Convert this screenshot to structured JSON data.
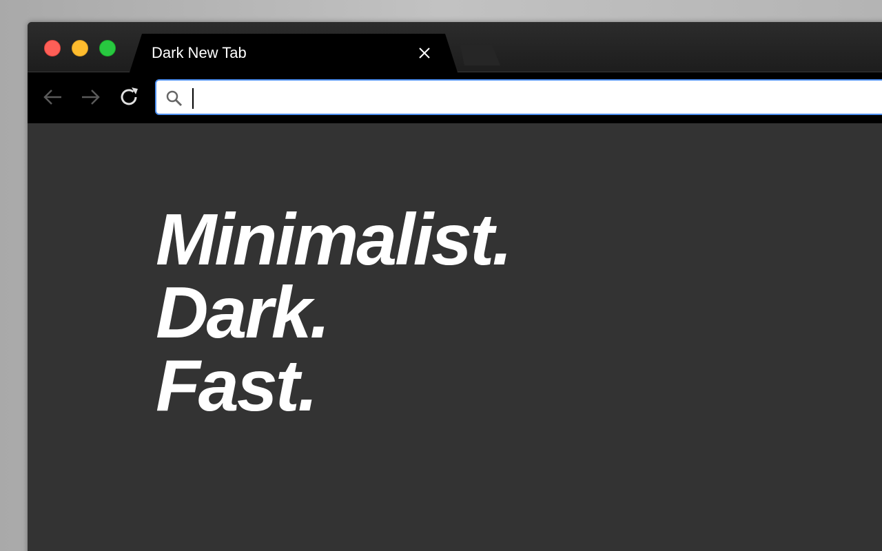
{
  "window": {
    "controls": {
      "close": "close-window",
      "minimize": "minimize-window",
      "maximize": "maximize-window"
    }
  },
  "tabs": [
    {
      "title": "Dark New Tab",
      "active": true
    }
  ],
  "toolbar": {
    "back_icon": "arrow-left-icon",
    "forward_icon": "arrow-right-icon",
    "reload_icon": "reload-icon",
    "omnibox": {
      "value": "",
      "placeholder": "",
      "icon": "search-icon"
    }
  },
  "hero": {
    "lines": [
      "Minimalist.",
      "Dark.",
      "Fast."
    ]
  },
  "colors": {
    "page_background": "#333333",
    "toolbar_background": "#000000",
    "omnibox_border": "#4d8ff0",
    "traffic_close": "#fe5f57",
    "traffic_minimize": "#febc2e",
    "traffic_maximize": "#28c840",
    "hero_text": "#ffffff"
  }
}
